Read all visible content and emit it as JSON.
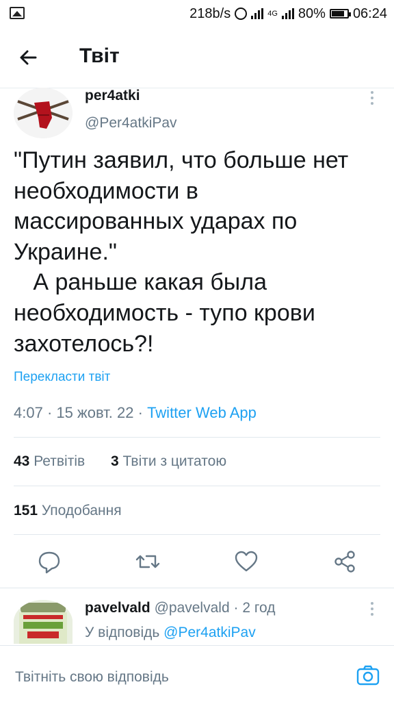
{
  "status_bar": {
    "speed": "218b/s",
    "network": "4G",
    "battery": "80%",
    "time": "06:24"
  },
  "header": {
    "title": "Твіт"
  },
  "tweet": {
    "author_name": "per4atki",
    "author_handle": "@Per4atkiPav",
    "text": "\"Путин заявил, что больше нет\nнеобходимости в\nмассированных ударах по\nУкраине.\"\n   А раньше какая была\nнеобходимость - тупо крови\nзахотелось?!",
    "translate_label": "Перекласти твіт",
    "time": "4:07",
    "date": "15 жовт. 22",
    "separator": "·",
    "source": "Twitter Web App",
    "retweets_count": "43",
    "retweets_label": "Ретвітів",
    "quotes_count": "3",
    "quotes_label": "Твіти з цитатою",
    "likes_count": "151",
    "likes_label": "Уподобання"
  },
  "actions": {
    "icons": [
      "reply-icon",
      "retweet-icon",
      "like-icon",
      "share-icon"
    ]
  },
  "reply": {
    "author_name": "pavelvald",
    "author_handle": "@pavelvald",
    "separator": "·",
    "age": "2 год",
    "reply_prefix": "У відповідь",
    "reply_to": "@Per4atkiPav"
  },
  "compose": {
    "placeholder": "Твітніть свою відповідь"
  },
  "colors": {
    "accent": "#1da1f2",
    "secondary_text": "#657786",
    "divider": "#e1e8ed"
  }
}
